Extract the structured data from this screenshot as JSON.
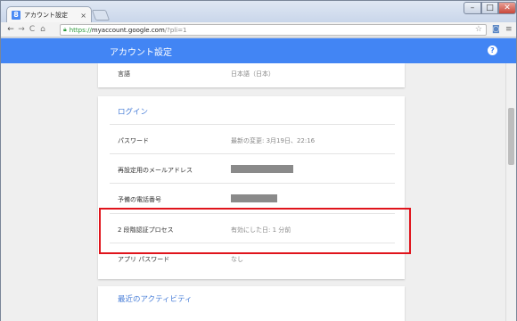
{
  "browser": {
    "tab_title": "アカウント設定",
    "tab_favicon": "8",
    "tab_close": "×",
    "url_scheme": "https://",
    "url_host": "myaccount.google.com",
    "url_path": "/?pli=1",
    "icons": [
      "back-icon",
      "forward-icon",
      "reload-icon",
      "home-icon",
      "lock-icon",
      "star-icon",
      "camera-icon",
      "menu-icon"
    ]
  },
  "appbar": {
    "title": "アカウント設定",
    "help": "?",
    "color": "#4285f4"
  },
  "top_card": {
    "label": "言語",
    "value": "日本語（日本）"
  },
  "login": {
    "title": "ログイン",
    "rows": [
      {
        "label": "パスワード",
        "value": "最新の変更: 3月19日、22:16"
      },
      {
        "label": "再設定用のメールアドレス",
        "value": ""
      },
      {
        "label": "予備の電話番号",
        "value": ""
      },
      {
        "label": "2 段階認証プロセス",
        "value": "有効にした日: 1 分前"
      },
      {
        "label": "アプリ パスワード",
        "value": "なし"
      }
    ]
  },
  "activity": {
    "title": "最近のアクティビティ"
  },
  "highlight_color": "#e0141c"
}
